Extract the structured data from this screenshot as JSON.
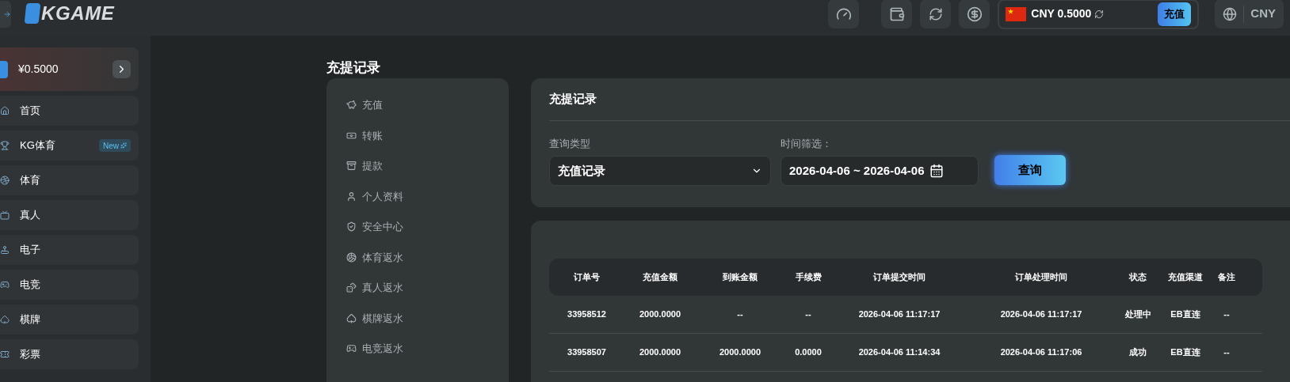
{
  "header": {
    "logo": "KGAME",
    "balance": "CNY 0.5000",
    "deposit_button": "充值",
    "currency": "CNY"
  },
  "sidebar": {
    "wallet": "¥0.5000",
    "items": [
      {
        "label": "首页",
        "selected": false
      },
      {
        "label": "KG体育",
        "badge": "New",
        "selected": false
      },
      {
        "label": "体育",
        "selected": false
      },
      {
        "label": "真人",
        "selected": false
      },
      {
        "label": "电子",
        "selected": false
      },
      {
        "label": "电竞",
        "selected": false
      },
      {
        "label": "棋牌",
        "selected": false
      },
      {
        "label": "彩票",
        "selected": false
      }
    ]
  },
  "page_title": "充提记录",
  "menu": [
    {
      "label": "充值",
      "selected": false
    },
    {
      "label": "转账",
      "selected": false
    },
    {
      "label": "提款",
      "selected": false
    },
    {
      "label": "个人资料",
      "selected": false
    },
    {
      "label": "安全中心",
      "selected": false
    },
    {
      "label": "体育返水",
      "selected": false
    },
    {
      "label": "真人返水",
      "selected": false
    },
    {
      "label": "棋牌返水",
      "selected": false
    },
    {
      "label": "电竞返水",
      "selected": false
    }
  ],
  "filter": {
    "title": "充提记录",
    "type_label": "查询类型",
    "type_value": "充值记录",
    "date_label": "时间筛选：",
    "date_value": "2026-04-06 ~ 2026-04-06",
    "query_button": "查询"
  },
  "table": {
    "columns": [
      "订单号",
      "充值金额",
      "到账金额",
      "手续费",
      "订单提交时间",
      "订单处理时间",
      "状态",
      "充值渠道",
      "备注"
    ],
    "rows": [
      [
        "33958512",
        "2000.0000",
        "--",
        "--",
        "2026-04-06 11:17:17",
        "2026-04-06 11:17:17",
        "处理中",
        "EB直连",
        "--"
      ],
      [
        "33958507",
        "2000.0000",
        "2000.0000",
        "0.0000",
        "2026-04-06 11:14:34",
        "2026-04-06 11:17:06",
        "成功",
        "EB直连",
        "--"
      ]
    ]
  }
}
